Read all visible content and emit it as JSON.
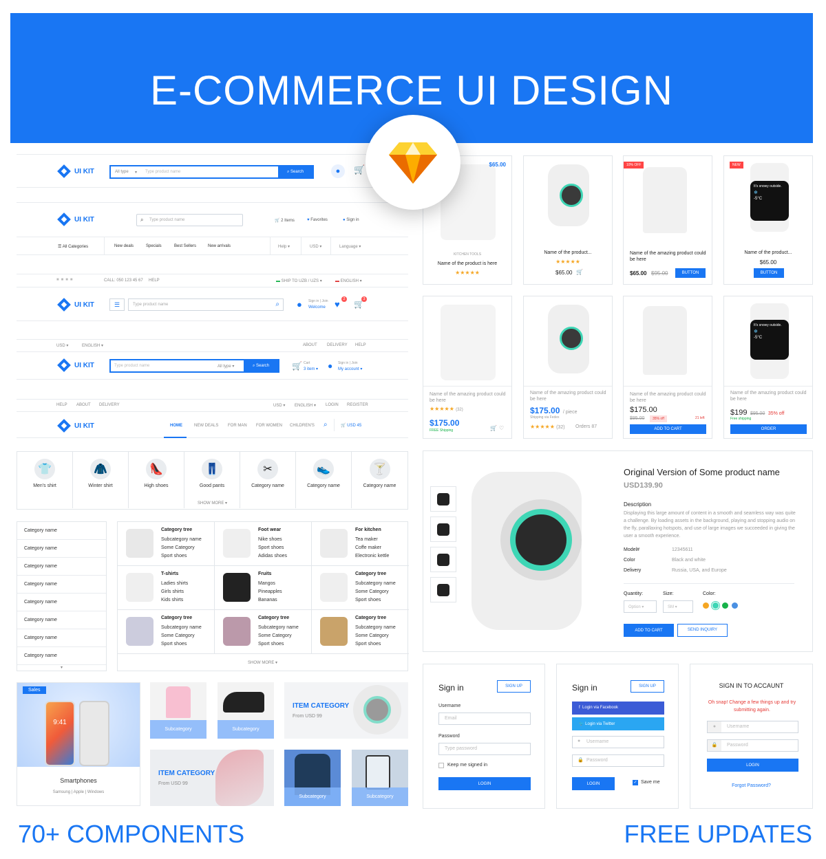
{
  "hero": {
    "title": "E-COMMERCE UI DESIGN"
  },
  "footer": {
    "left": "70+ COMPONENTS",
    "right": "FREE UPDATES"
  },
  "header1": {
    "logo": "UI KIT",
    "type_select": "All type",
    "search_placeholder": "Type product name",
    "search_button": "Search"
  },
  "header2": {
    "logo": "UI KIT",
    "search_placeholder": "Type product name",
    "items": "2 Items",
    "favorites": "Favorites",
    "signin": "Sign in",
    "nav": [
      "All Categories",
      "New deals",
      "Specials",
      "Best Sellers",
      "New arrivals"
    ],
    "help": "Help",
    "currency": "USD",
    "language": "Language"
  },
  "header3": {
    "call": "CALL: 050 123 45 67",
    "help": "HELP",
    "ship": "SHIP TO UZB / UZS",
    "lang": "ENGLISH",
    "logo": "UI KIT",
    "search_placeholder": "Type product name",
    "signin_small": "Sign in | Join",
    "welcome": "Welcome",
    "fav_count": "2",
    "cart_count": "3"
  },
  "header4": {
    "currency": "USD",
    "lang": "ENGLISH",
    "about": "ABOUT",
    "delivery": "DELIVERY",
    "help": "HELP",
    "logo": "UI KIT",
    "search_placeholder": "Type product name",
    "type_select": "All type",
    "search_button": "Search",
    "cart_label": "Cart",
    "cart_items": "3 item",
    "signin_small": "Sign in | Join",
    "account": "My account"
  },
  "header5": {
    "help": "HELP",
    "about": "ABOUT",
    "delivery": "DELIVERY",
    "currency": "USD",
    "lang": "ENGLISH",
    "login": "LOGIN",
    "register": "REGISTER",
    "logo": "UI KIT",
    "nav": [
      "HOME",
      "NEW DEALS",
      "FOR MAN",
      "FOR WOMEN",
      "CHILDREN'S"
    ],
    "cart_total": "USD 45"
  },
  "categories": {
    "items": [
      "Men's shirt",
      "Winter shirt",
      "High shoes",
      "Good pants",
      "Category name",
      "Category name",
      "Category name"
    ],
    "show_more": "SHOW MORE"
  },
  "category_list": [
    "Category name",
    "Category name",
    "Category name",
    "Category name",
    "Category name",
    "Category name",
    "Category name",
    "Category name"
  ],
  "category_grid": {
    "cells": [
      {
        "title": "Category tree",
        "subs": [
          "Subcategory name",
          "Some Category",
          "Sport shoes"
        ]
      },
      {
        "title": "Foot wear",
        "subs": [
          "Nike shoes",
          "Sport shoes",
          "Adidas shoes"
        ]
      },
      {
        "title": "For kitchen",
        "subs": [
          "Tea maker",
          "Coffe maker",
          "Electronic kettle"
        ]
      },
      {
        "title": "T-shirts",
        "subs": [
          "Ladies shirts",
          "Girls shirts",
          "Kids shirts"
        ]
      },
      {
        "title": "Fruits",
        "subs": [
          "Mangos",
          "Pineapples",
          "Bananas"
        ]
      },
      {
        "title": "Category tree",
        "subs": [
          "Subcategory name",
          "Some Category",
          "Sport shoes"
        ]
      },
      {
        "title": "Category tree",
        "subs": [
          "Subcategory name",
          "Some Category",
          "Sport shoes"
        ]
      },
      {
        "title": "Category tree",
        "subs": [
          "Subcategory name",
          "Some Category",
          "Sport shoes"
        ]
      },
      {
        "title": "Category tree",
        "subs": [
          "Subcategory name",
          "Some Category",
          "Sport shoes"
        ]
      }
    ],
    "show_more": "SHOW MORE"
  },
  "promo": {
    "sales": "Sales",
    "phone_time": "9:41",
    "smartphones": "Smartphones",
    "brands": "Samsung  |  Apple  |  Windows",
    "subcategory": "Subcategory",
    "item_category": "ITEM CATEGORY",
    "from": "From USD 99"
  },
  "products_row1": [
    {
      "price_tag": "$65.00",
      "kicker": "KITCHEN TOOLS",
      "name": "Name of the product is here"
    },
    {
      "name": "Name of the product...",
      "price": "$65.00"
    },
    {
      "badge": "10% OFF",
      "name": "Name of the amazing product could be here",
      "price": "$65.00",
      "old": "$95.00",
      "button": "BUTTON"
    },
    {
      "badge": "NEW",
      "name": "Name of the product...",
      "price": "$65.00",
      "button": "BUTTON",
      "watch_text": "It's snowy outside.",
      "temp": "-5°C"
    }
  ],
  "products_row2": [
    {
      "name": "Name of the amazing product could be here",
      "reviews": "(32)",
      "price": "$175.00",
      "shipping": "FREE Shipping"
    },
    {
      "name": "Name of the amazing product could be here",
      "price": "$175.00",
      "unit": "/ piece",
      "shipping": "Shipping via Fedex",
      "reviews": "(32)",
      "orders": "Orders 87"
    },
    {
      "name": "Name of the amazing product could be here",
      "price": "$175.00",
      "old": "$95.00",
      "off": "35% off",
      "left": "21 left",
      "button": "ADD TO CART"
    },
    {
      "name": "Name of the amazing product could be here",
      "price": "$199",
      "old": "$95.00",
      "off": "35% off",
      "shipping": "Free shipping",
      "button": "ORDER",
      "watch_text": "It's snowy outside.",
      "temp": "-5°C"
    }
  ],
  "detail": {
    "title": "Original Version of Some product name",
    "price": "USD139.90",
    "desc_label": "Description",
    "desc": "Displaying this large amount of content in a smooth and seamless way was quite a challenge. By loading assets in the background, playing and stopping audio on the fly, parallaxing hotspots, and use of large images we succeeded in giving the user a smooth experience.",
    "specs": [
      {
        "k": "Model#",
        "v": "12345611"
      },
      {
        "k": "Color",
        "v": "Black and white"
      },
      {
        "k": "Delivery",
        "v": "Russia, USA, and Europe"
      }
    ],
    "quantity_label": "Quantity:",
    "quantity": "Option",
    "size_label": "Size:",
    "size": "SM",
    "color_label": "Color:",
    "colors": [
      "#f5a623",
      "#3ed6b5",
      "#17b24a",
      "#4a90e2"
    ],
    "add": "ADD TO CART",
    "inquiry": "SEND INQUIRY"
  },
  "signin1": {
    "title": "Sign in",
    "signup": "SIGN UP",
    "username_label": "Username",
    "username_ph": "Email",
    "password_label": "Password",
    "password_ph": "Type password",
    "keep": "Keep me signed in",
    "login": "LOGIN"
  },
  "signin2": {
    "title": "Sign in",
    "signup": "SIGN UP",
    "facebook": "Login via Facebook",
    "twitter": "Login via Twitter",
    "username_ph": "Username",
    "password_ph": "Password",
    "login": "LOGIN",
    "save": "Save me"
  },
  "signin3": {
    "title": "SIGN IN TO ACCAUNT",
    "error": "Oh snap! Change a few things up and try submitting again.",
    "username_ph": "Username",
    "password_ph": "Password",
    "login": "LOGIN",
    "forgot": "Forgot Password?"
  },
  "colors": {
    "accent": "#1976f3",
    "star": "#f5a623",
    "error": "#e53935"
  }
}
